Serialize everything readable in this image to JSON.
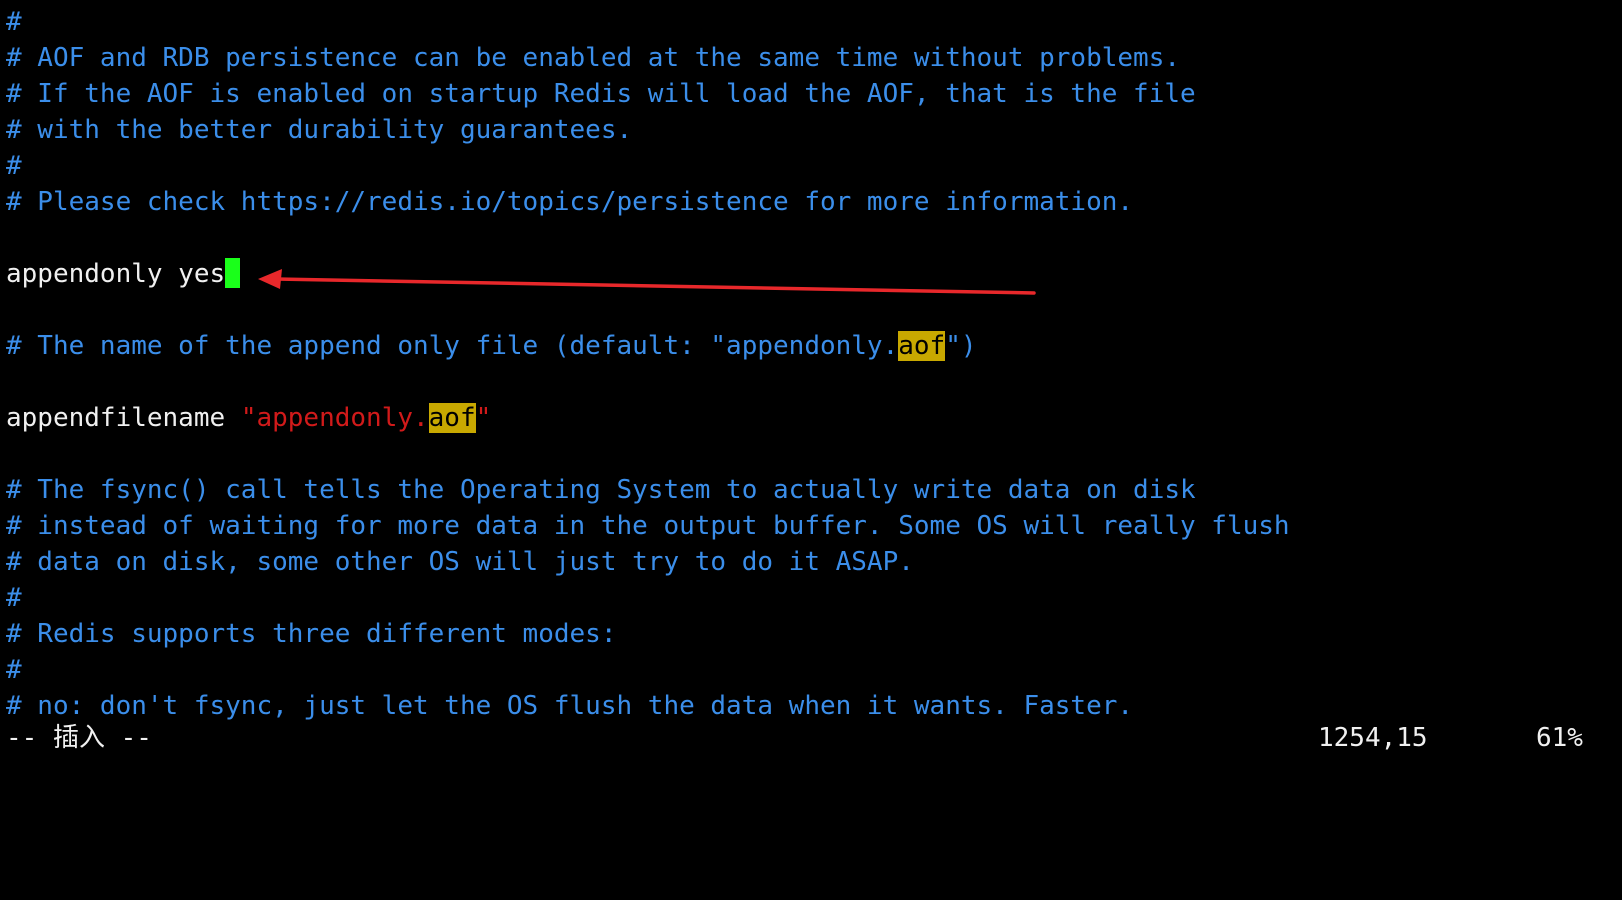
{
  "editor": {
    "colors": {
      "background": "#000000",
      "comment": "#3b8eea",
      "text": "#f0f0f0",
      "string": "#d11a1a",
      "search_highlight": "#c8a800",
      "cursor": "#1aff1a",
      "annotation_arrow": "#e8282b"
    },
    "lines": {
      "l0": "#",
      "l1": "# AOF and RDB persistence can be enabled at the same time without problems.",
      "l2": "# If the AOF is enabled on startup Redis will load the AOF, that is the file",
      "l3": "# with the better durability guarantees.",
      "l4": "#",
      "l5": "# Please check https://redis.io/topics/persistence for more information.",
      "l7": "appendonly yes",
      "l9_pre": "# The name of the append only file (default: \"appendonly.",
      "l9_hl": "aof",
      "l9_post": "\")",
      "l11_key": "appendfilename ",
      "l11_q1": "\"",
      "l11_str": "appendonly.",
      "l11_hl": "aof",
      "l11_q2": "\"",
      "l13": "# The fsync() call tells the Operating System to actually write data on disk",
      "l14": "# instead of waiting for more data in the output buffer. Some OS will really flush",
      "l15": "# data on disk, some other OS will just try to do it ASAP.",
      "l16": "#",
      "l17": "# Redis supports three different modes:",
      "l18": "#",
      "l19": "# no: don't fsync, just let the OS flush the data when it wants. Faster."
    }
  },
  "statusbar": {
    "mode": "-- 插入 --",
    "position": "1254,15",
    "percent": "61%"
  }
}
